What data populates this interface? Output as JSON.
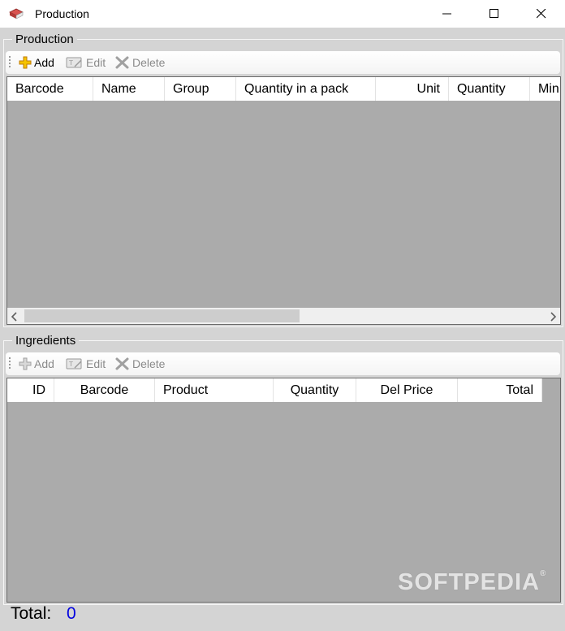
{
  "window": {
    "title": "Production",
    "app_icon": "books-icon",
    "controls": [
      "minimize-icon",
      "maximize-icon",
      "close-icon"
    ]
  },
  "production": {
    "group_label": "Production",
    "toolbar": {
      "add_label": "Add",
      "edit_label": "Edit",
      "delete_label": "Delete",
      "add_enabled": true,
      "edit_enabled": false,
      "delete_enabled": false
    },
    "columns": [
      "Barcode",
      "Name",
      "Group",
      "Quantity in a pack",
      "Unit",
      "Quantity",
      "Min"
    ],
    "rows": [],
    "hscroll_thumb_fraction": 0.53
  },
  "ingredients": {
    "group_label": "Ingredients",
    "toolbar": {
      "add_label": "Add",
      "edit_label": "Edit",
      "delete_label": "Delete",
      "add_enabled": false,
      "edit_enabled": false,
      "delete_enabled": false
    },
    "columns": [
      "ID",
      "Barcode",
      "Product",
      "Quantity",
      "Del Price",
      "Total"
    ],
    "rows": []
  },
  "footer": {
    "total_label": "Total:",
    "total_value": "0"
  },
  "watermark": {
    "text": "SOFTPEDIA",
    "mark": "®"
  },
  "colors": {
    "window_bg": "#d4d4d4",
    "grid_bg": "#ababab",
    "total_value": "#0000e0"
  }
}
